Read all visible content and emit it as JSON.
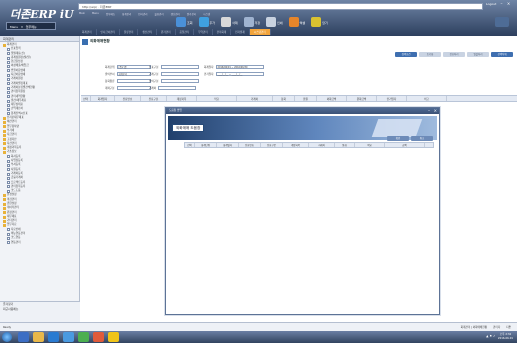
{
  "app": {
    "logo": "더존ERP iU",
    "menu_label": "Menu",
    "user_label": "업무메뉴"
  },
  "browser": {
    "url": "http://erp/ · 더존ERP",
    "logout": "Logout"
  },
  "tabs": [
    "Main",
    "Menu",
    "업무메뉴",
    "회계관리",
    "인사관리",
    "물류관리",
    "생산관리",
    "원가관리",
    "시스템"
  ],
  "top_icons": [
    {
      "name": "search",
      "label": "조회",
      "color": "#4a90d8"
    },
    {
      "name": "add",
      "label": "추가",
      "color": "#3fa0e0"
    },
    {
      "name": "delete",
      "label": "삭제",
      "color": "#d8d8d8"
    },
    {
      "name": "save",
      "label": "저장",
      "color": "#9fb3d0"
    },
    {
      "name": "print",
      "label": "인쇄",
      "color": "#c8d2e0"
    },
    {
      "name": "excel",
      "label": "엑셀",
      "color": "#e6852a"
    },
    {
      "name": "close",
      "label": "닫기",
      "color": "#d9c230"
    }
  ],
  "main_nav": [
    "회계관리",
    "인사급여관리",
    "물류관리",
    "생산관리",
    "원가관리",
    "품질관리",
    "무역관리",
    "관리회계",
    "전자결재",
    "시스템관리"
  ],
  "main_nav_active_index": 9,
  "sidebar": {
    "header": "회계관리",
    "tree": [
      {
        "label": "회계관리",
        "type": "folder"
      },
      {
        "label": "전표입력",
        "type": "doc"
      },
      {
        "label": "일월계표(신)",
        "type": "doc"
      },
      {
        "label": "총계정원장(월/일)",
        "type": "doc"
      },
      {
        "label": "현금출납장",
        "type": "doc"
      },
      {
        "label": "외상매출/매입금",
        "type": "doc"
      },
      {
        "label": "받을어음명세",
        "type": "doc"
      },
      {
        "label": "지급어음명세",
        "type": "doc"
      },
      {
        "label": "거래처원장",
        "type": "doc"
      },
      {
        "label": "거래처별집계표",
        "type": "doc"
      },
      {
        "label": "거래처분류별잔액현황",
        "type": "doc"
      },
      {
        "label": "관리항목원장",
        "type": "doc"
      },
      {
        "label": "관리내역현황",
        "type": "doc"
      },
      {
        "label": "결산/재무제표",
        "type": "doc"
      },
      {
        "label": "재무상태표",
        "type": "doc"
      },
      {
        "label": "손익계산서",
        "type": "doc"
      },
      {
        "label": "합계잔액시산표",
        "type": "doc"
      },
      {
        "label": "전기분재무제표",
        "type": "folder"
      },
      {
        "label": "예산관리",
        "type": "folder"
      },
      {
        "label": "업무용차량",
        "type": "folder"
      },
      {
        "label": "부가세",
        "type": "folder"
      },
      {
        "label": "자금관리",
        "type": "folder"
      },
      {
        "label": "고정자산",
        "type": "folder"
      },
      {
        "label": "자산관리",
        "type": "folder"
      },
      {
        "label": "계정과목등록",
        "type": "folder"
      },
      {
        "label": "기초정보",
        "type": "folder"
      },
      {
        "label": "회사등록",
        "type": "doc"
      },
      {
        "label": "사업장등록",
        "type": "doc"
      },
      {
        "label": "부서등록",
        "type": "doc"
      },
      {
        "label": "사원등록",
        "type": "doc"
      },
      {
        "label": "거래처등록",
        "type": "doc"
      },
      {
        "label": "금융거래처",
        "type": "doc"
      },
      {
        "label": "프로젝트등록",
        "type": "doc"
      },
      {
        "label": "관리항목등록",
        "type": "doc"
      },
      {
        "label": "코드도움",
        "type": "doc"
      },
      {
        "label": "환경설정",
        "type": "folder"
      },
      {
        "label": "마감관리",
        "type": "folder"
      },
      {
        "label": "권한설정",
        "type": "folder"
      },
      {
        "label": "데이터관리",
        "type": "folder"
      },
      {
        "label": "원장관리",
        "type": "folder"
      },
      {
        "label": "재무제표",
        "type": "folder"
      },
      {
        "label": "기타관리",
        "type": "folder"
      },
      {
        "label": "업무자료",
        "type": "folder"
      },
      {
        "label": "자료인쇄",
        "type": "doc"
      },
      {
        "label": "메뉴연동관리",
        "type": "doc"
      },
      {
        "label": "코드연동",
        "type": "doc"
      },
      {
        "label": "연동관리",
        "type": "doc"
      }
    ],
    "footer": [
      "즐겨찾기",
      "최근사용메뉴"
    ]
  },
  "content": {
    "tab_title": "외화매매현황",
    "buttons": [
      "검색조건",
      "초기화",
      "전표처리",
      "일괄처리",
      "선택삭제"
    ],
    "form": {
      "row1": {
        "label1": "회계단위",
        "value1": "(주)더존",
        "label2": "전표구분",
        "value2": "",
        "label3": "회계일자",
        "value3": "2016/06/01 ~ 2016/06/30"
      },
      "row2": {
        "label1": "결의부서",
        "value1": "회계부서",
        "label2": "거래구분",
        "value2": "",
        "label3": "만기일자",
        "value3": "____/__/__ ~ ____/__/__"
      },
      "row3": {
        "label1": "통화종류",
        "value1": "",
        "label2": "결의구분",
        "value2": ""
      },
      "row4": {
        "label1": "계좌구분",
        "value1": "",
        "label2": "거래처",
        "value2": ""
      }
    },
    "grid_columns": [
      "선택",
      "회계일자",
      "전표번호",
      "전표구분",
      "계정과목",
      "적요",
      "거래처",
      "통화",
      "환율",
      "외화금액",
      "원화금액",
      "만기일자",
      "비고"
    ]
  },
  "modal": {
    "title": "도움창 팝업",
    "header_title": "외화매매 도움창",
    "buttons": [
      "확인",
      "취소"
    ],
    "columns": [
      "선택",
      "회계단위",
      "회계일자",
      "전표번호",
      "전표구분",
      "계정과목",
      "거래처",
      "통화",
      "적요",
      "금액"
    ]
  },
  "status": {
    "left": "Ready",
    "items": [
      "회계관리 | 외화매매현황",
      "관리자",
      "더존"
    ]
  },
  "taskbar": {
    "time": "오후 2:32",
    "date": "2016-06-01"
  }
}
